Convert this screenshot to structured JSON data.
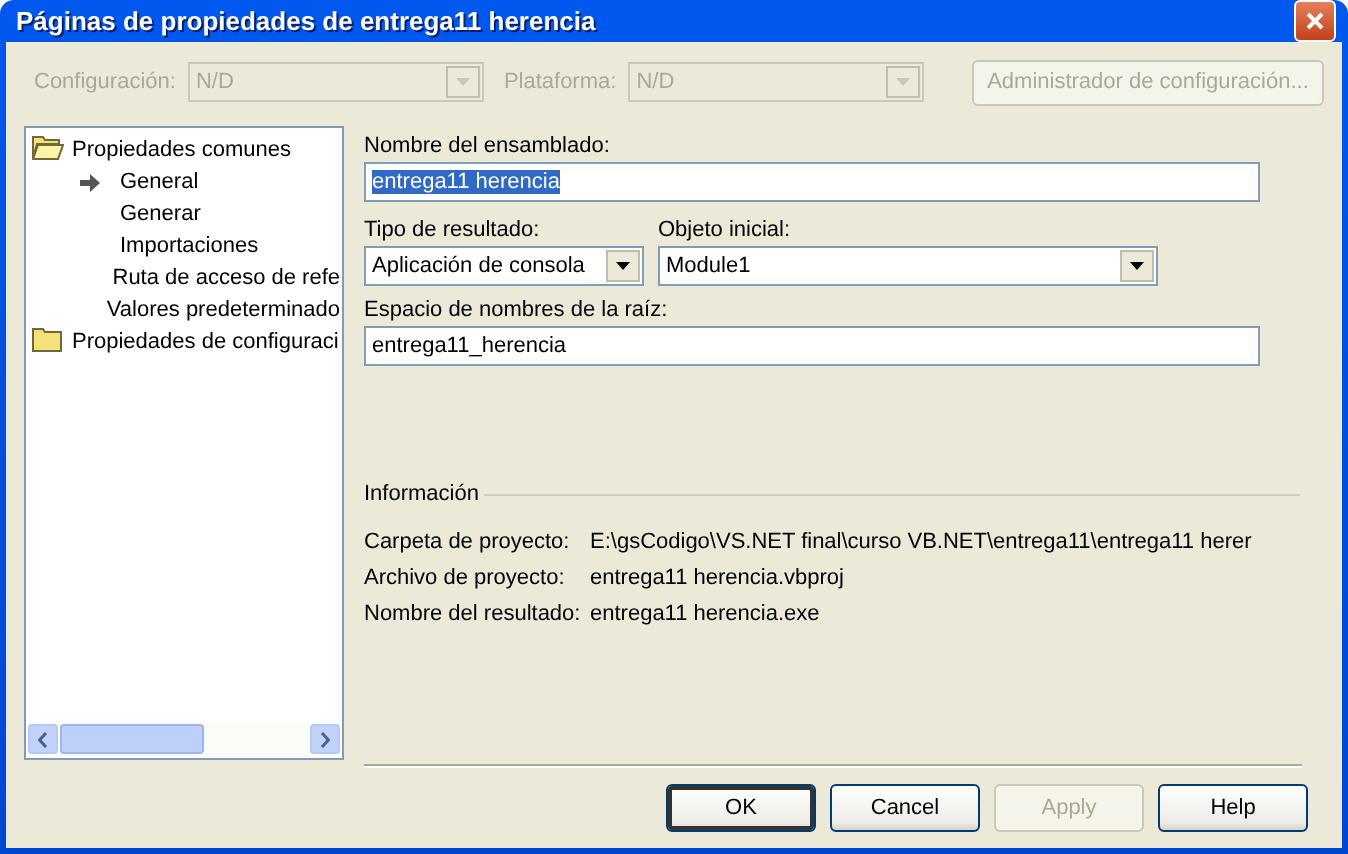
{
  "window": {
    "title": "Páginas de propiedades de entrega11 herencia"
  },
  "toolbar": {
    "configuration": {
      "label": "Configuración:",
      "value": "N/D",
      "disabled": true
    },
    "platform": {
      "label": "Plataforma:",
      "value": "N/D",
      "disabled": true
    },
    "manager_button": {
      "label": "Administrador de configuración...",
      "disabled": true
    }
  },
  "tree": {
    "items": [
      {
        "label": "Propiedades comunes",
        "selected": false,
        "expanded": true,
        "children": [
          {
            "label": "General",
            "selected": true
          },
          {
            "label": "Generar",
            "selected": false
          },
          {
            "label": "Importaciones",
            "selected": false
          },
          {
            "label": "Ruta de acceso de refe",
            "selected": false
          },
          {
            "label": "Valores predeterminado",
            "selected": false
          }
        ]
      },
      {
        "label": "Propiedades de configuraci",
        "selected": false,
        "expanded": false
      }
    ]
  },
  "form": {
    "assembly_name": {
      "label": "Nombre del ensamblado:",
      "value": "entrega11 herencia",
      "text_selected": true
    },
    "output_type": {
      "label": "Tipo de resultado:",
      "value": "Aplicación de consola"
    },
    "startup_object": {
      "label": "Objeto inicial:",
      "value": "Module1"
    },
    "root_namespace": {
      "label": "Espacio de nombres de la raíz:",
      "value": "entrega11_herencia",
      "text_selected": false
    }
  },
  "info": {
    "title": "Información",
    "rows": [
      {
        "label": "Carpeta de proyecto:",
        "value": "E:\\gsCodigo\\VS.NET final\\curso VB.NET\\entrega11\\entrega11 herer"
      },
      {
        "label": "Archivo de proyecto:",
        "value": "entrega11 herencia.vbproj"
      },
      {
        "label": "Nombre del resultado:",
        "value": "entrega11 herencia.exe"
      }
    ]
  },
  "buttons": [
    {
      "label": "OK",
      "default": true,
      "disabled": false
    },
    {
      "label": "Cancel",
      "default": false,
      "disabled": false
    },
    {
      "label": "Apply",
      "default": false,
      "disabled": true
    },
    {
      "label": "Help",
      "default": false,
      "disabled": false
    }
  ]
}
